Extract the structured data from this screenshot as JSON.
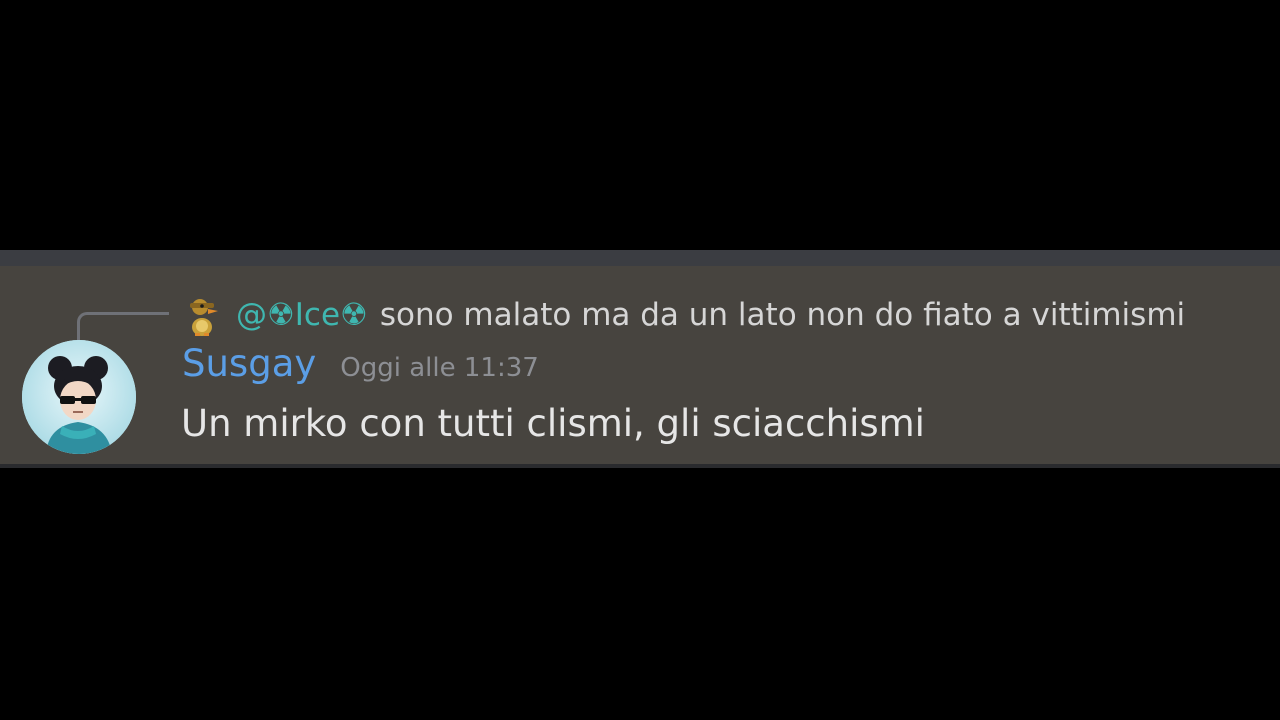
{
  "reply": {
    "mention": "@☢Ice☢",
    "text": "sono malato ma da un lato non do fiato a vittimismi",
    "avatar_icon": "duck-avatar-icon"
  },
  "message": {
    "username": "Susgay",
    "timestamp": "Oggi alle 11:37",
    "content": "Un mirko con tutti clismi, gli sciacchismi",
    "avatar_icon": "user-avatar-icon"
  },
  "colors": {
    "background": "#000000",
    "message_band": "#47443f",
    "username": "#5b9ee6",
    "mention": "#3fb7b0",
    "timestamp": "#8d8f94",
    "content": "#e6e6e6"
  }
}
